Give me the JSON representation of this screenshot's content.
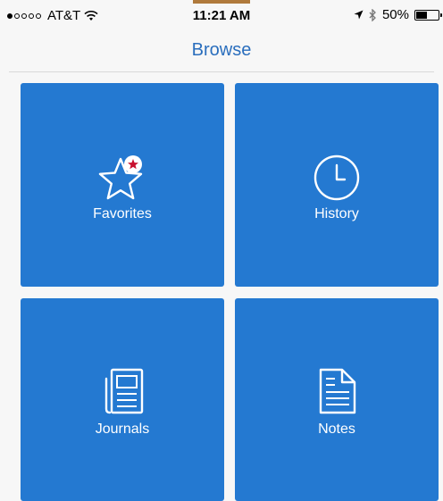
{
  "status_bar": {
    "carrier": "AT&T",
    "time": "11:21 AM",
    "battery_percent": "50%",
    "battery_level": 0.5
  },
  "nav": {
    "title": "Browse"
  },
  "tiles": [
    {
      "label": "Favorites",
      "icon": "star-icon"
    },
    {
      "label": "History",
      "icon": "clock-icon"
    },
    {
      "label": "Journals",
      "icon": "journal-icon"
    },
    {
      "label": "Notes",
      "icon": "notes-icon"
    }
  ],
  "colors": {
    "tile": "#2479d1",
    "nav_title": "#2a6ebd",
    "favorite_badge": "#c8102e"
  }
}
